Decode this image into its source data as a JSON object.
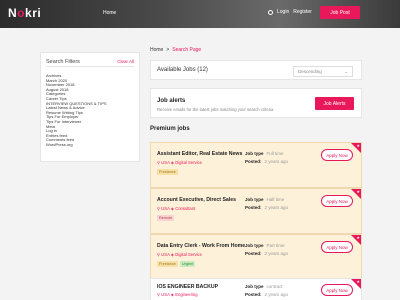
{
  "header": {
    "logo_n": "N",
    "logo_k": "o",
    "logo_rest": "kri",
    "nav_home": "Home",
    "login": "Login",
    "register": "Register",
    "job_post": "Job Post"
  },
  "sidebar": {
    "title": "Search Filters",
    "clear_all": "Clear All",
    "items": [
      "Archives",
      "March 2020",
      "November 2018",
      "August 2018",
      "Categories",
      "Career Tips",
      "INTERVIEW QUESTIONS & TIPS",
      "Latest News & Advice",
      "Resume Writing Tips",
      "Tips For Employer",
      "Tips For Interviewer",
      "Meta",
      "Log in",
      "Entries feed",
      "Comments feed",
      "WordPress.org"
    ]
  },
  "breadcrumb": {
    "home": "Home",
    "sep": ">",
    "current": "Search Page"
  },
  "results": {
    "available_label": "Available Jobs (12)",
    "sort_value": "Descending",
    "sort_icon": "chevron-down-icon"
  },
  "alerts": {
    "title": "Job alerts",
    "description": "Receive emails for the latest jobs matching your search criteria",
    "button": "Job Alerts"
  },
  "premium_title": "Premium jobs",
  "jobs": [
    {
      "title": "Assistant Editor, Real Estate News",
      "location": "USA",
      "category": "Digital Service",
      "tags": [
        "Freelance"
      ],
      "job_type_label": "Job type",
      "job_type": "Full time",
      "posted_label": "Posted:",
      "posted": "2 years ago",
      "apply": "Apply Now"
    },
    {
      "title": "Account Executive, Direct Sales",
      "location": "USA",
      "category": "Consultant",
      "tags": [
        "Remote"
      ],
      "job_type_label": "Job type",
      "job_type": "Half time",
      "posted_label": "Posted:",
      "posted": "2 years ago",
      "apply": "Apply Now"
    },
    {
      "title": "Data Entry Clerk - Work From Home",
      "location": "USA",
      "category": "Digital Service",
      "tags": [
        "Freelance",
        "Urgent"
      ],
      "job_type_label": "Job type",
      "job_type": "Part time",
      "posted_label": "Posted:",
      "posted": "2 years ago",
      "apply": "Apply Now"
    },
    {
      "title": "IOS ENGINEER BACKUP",
      "location": "USA",
      "category": "Engineering",
      "tags": [],
      "job_type_label": "Job type",
      "job_type": "contract",
      "posted_label": "Posted:",
      "posted": "2 years ago",
      "apply": "Apply Now"
    }
  ],
  "colors": {
    "accent": "#e8185b",
    "premium_bg": "#fdf1d9"
  }
}
